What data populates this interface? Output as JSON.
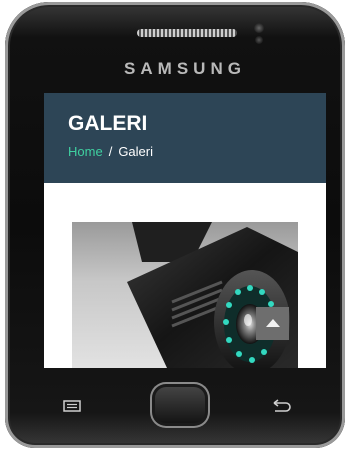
{
  "device": {
    "brand": "SAMSUNG",
    "icons": [
      "menu-icon",
      "home-icon",
      "back-icon"
    ]
  },
  "page": {
    "title": "GALERI",
    "breadcrumb": {
      "home": "Home",
      "separator": "/",
      "current": "Galeri"
    }
  },
  "colors": {
    "header_bg": "#2d4556",
    "breadcrumb_link": "#3fd0a0",
    "scroll_button_bg": "#6e6e6e"
  },
  "gallery": {
    "image_subject": "security camera"
  },
  "controls": {
    "scroll_top_icon": "caret-up-icon"
  }
}
